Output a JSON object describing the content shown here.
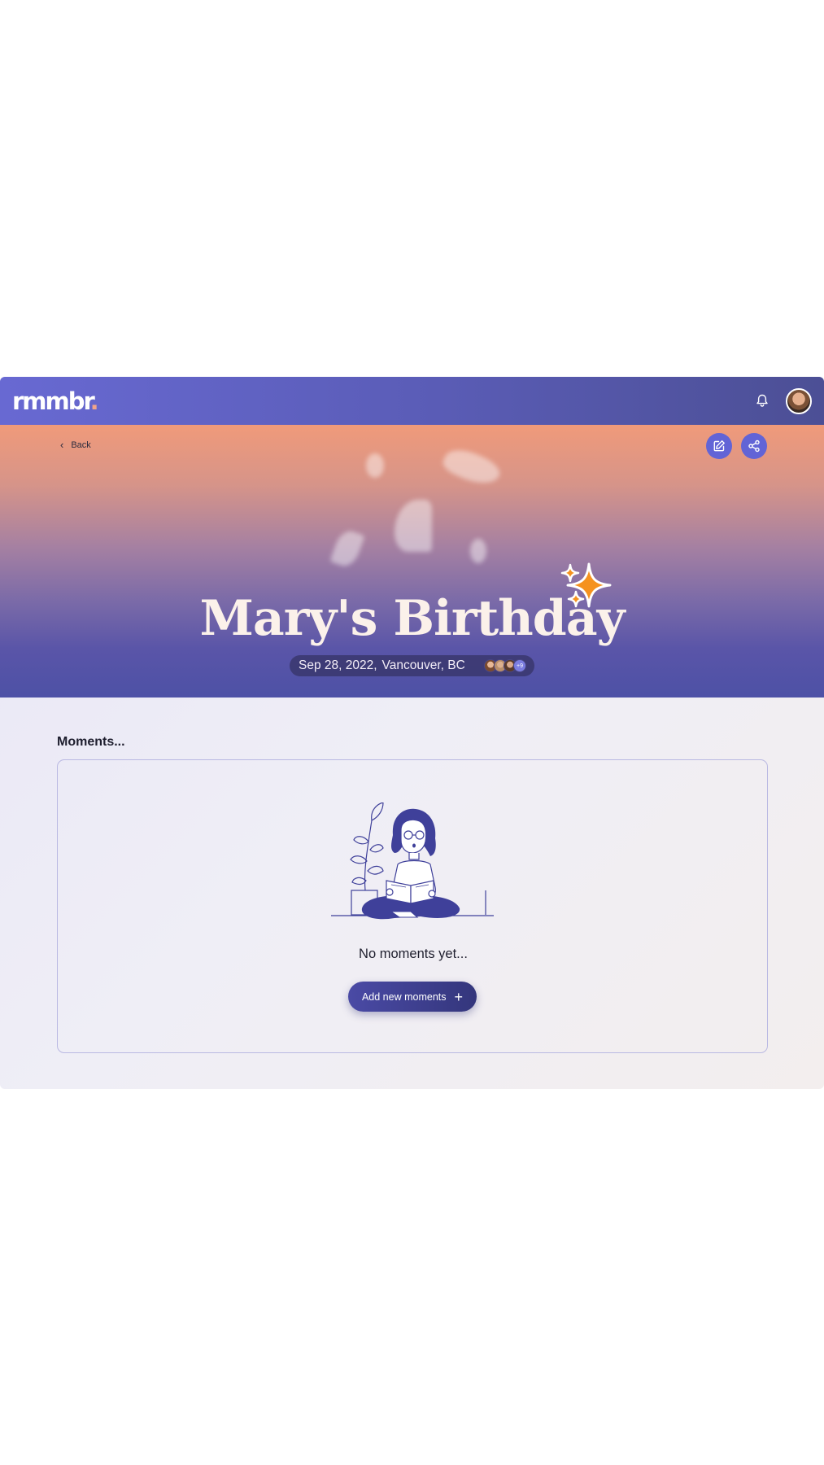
{
  "app": {
    "logo_text": "rmmbr",
    "logo_dot": "."
  },
  "header": {
    "bell_icon": "bell-icon",
    "avatar_icon": "user-avatar"
  },
  "hero": {
    "back_label": "Back",
    "title": "Mary's Birthday",
    "date": "Sep 28, 2022,",
    "location": "Vancouver, BC",
    "more_count": "+9",
    "edit_icon": "edit-icon",
    "share_icon": "share-icon"
  },
  "moments": {
    "section_label": "Moments...",
    "empty_text": "No moments yet...",
    "add_button": "Add new moments"
  },
  "colors": {
    "accent": "#6264d6",
    "primary_dark": "#3f409a",
    "sparkle": "#f28c1a"
  }
}
